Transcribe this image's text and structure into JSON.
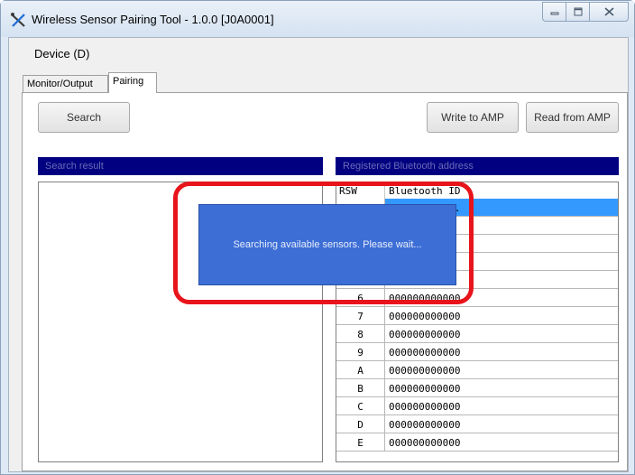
{
  "window": {
    "title": "Wireless Sensor Pairing Tool - 1.0.0 [J0A0001]",
    "icon": "crossed-tools-icon"
  },
  "menu": {
    "device": "Device (D)"
  },
  "tabs": [
    {
      "label": "Monitor/Output",
      "active": false
    },
    {
      "label": "Pairing",
      "active": true
    }
  ],
  "toolbar": {
    "search_label": "Search",
    "write_label": "Write to AMP",
    "read_label": "Read from AMP"
  },
  "panels": {
    "search_result_header": "Search result",
    "registered_header": "Registered Bluetooth address"
  },
  "grid": {
    "col_rsw": "RSW",
    "col_bt": "Bluetooth ID",
    "rows": [
      {
        "rsw": "",
        "bt": "............"
      },
      {
        "rsw": "",
        "bt": ""
      },
      {
        "rsw": "",
        "bt": ""
      },
      {
        "rsw": "",
        "bt": ""
      },
      {
        "rsw": "",
        "bt": ""
      },
      {
        "rsw": "6",
        "bt": "000000000000"
      },
      {
        "rsw": "7",
        "bt": "000000000000"
      },
      {
        "rsw": "8",
        "bt": "000000000000"
      },
      {
        "rsw": "9",
        "bt": "000000000000"
      },
      {
        "rsw": "A",
        "bt": "000000000000"
      },
      {
        "rsw": "B",
        "bt": "000000000000"
      },
      {
        "rsw": "C",
        "bt": "000000000000"
      },
      {
        "rsw": "D",
        "bt": "000000000000"
      },
      {
        "rsw": "E",
        "bt": "000000000000"
      }
    ]
  },
  "dialog": {
    "message": "Searching available sensors. Please wait..."
  },
  "colors": {
    "header_bg": "#000080",
    "selection": "#3399ff",
    "popup_bg": "#3d6ed6",
    "highlight": "#e8141b"
  }
}
